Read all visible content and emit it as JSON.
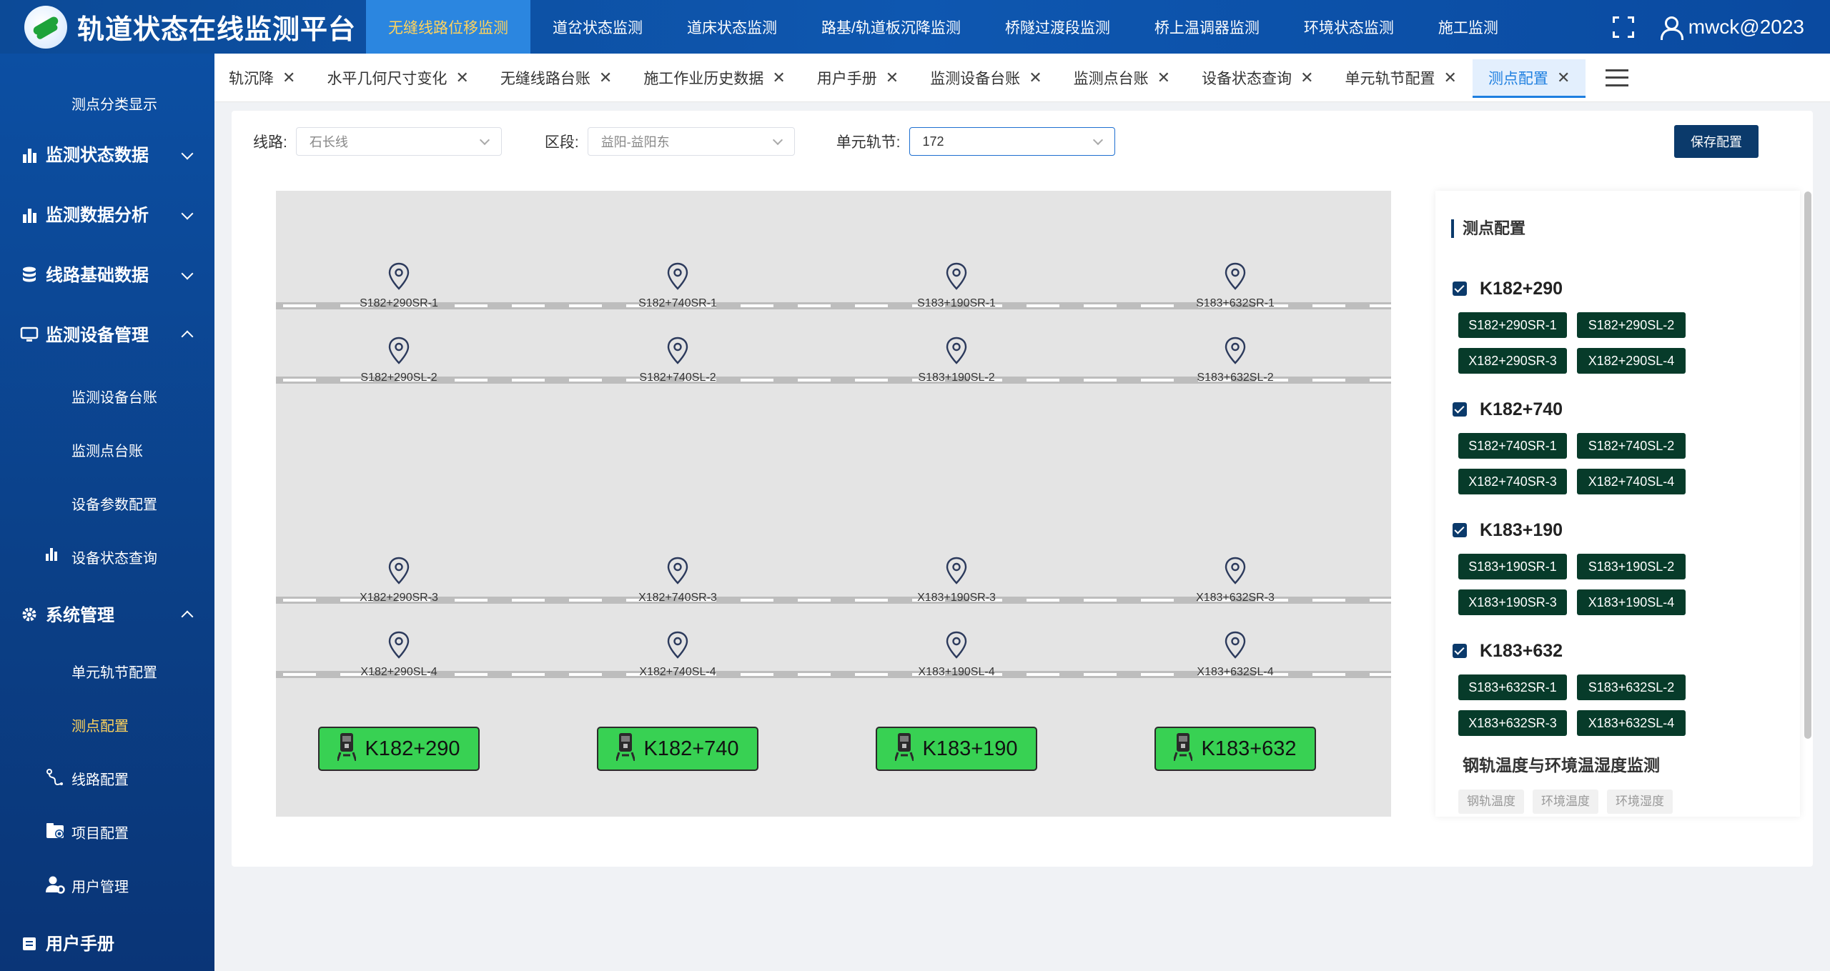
{
  "header": {
    "title": "轨道状态在线监测平台",
    "nav": [
      "无缝线路位移监测",
      "道岔状态监测",
      "道床状态监测",
      "路基/轨道板沉降监测",
      "桥隧过渡段监测",
      "桥上温调器监测",
      "环境状态监测",
      "施工监测"
    ],
    "username": "mwck@2023"
  },
  "sidebar": {
    "items": {
      "top_sub": "测点分类显示",
      "monitor_status": "监测状态数据",
      "monitor_analysis": "监测数据分析",
      "line_base": "线路基础数据",
      "device_mgmt": "监测设备管理",
      "device_ledger": "监测设备台账",
      "point_ledger": "监测点台账",
      "param_config": "设备参数配置",
      "status_query": "设备状态查询",
      "system_mgmt": "系统管理",
      "unit_config": "单元轨节配置",
      "point_config": "测点配置",
      "line_config": "线路配置",
      "project_config": "项目配置",
      "user_mgmt": "用户管理",
      "user_manual": "用户手册"
    }
  },
  "tabs": {
    "t0": "轨沉降",
    "t1": "水平几何尺寸变化",
    "t2": "无缝线路台账",
    "t3": "施工作业历史数据",
    "t4": "用户手册",
    "t5": "监测设备台账",
    "t6": "监测点台账",
    "t7": "设备状态查询",
    "t8": "单元轨节配置",
    "t9": "测点配置"
  },
  "filters": {
    "line_label": "线路:",
    "line_value": "石长线",
    "section_label": "区段:",
    "section_value": "益阳-益阳东",
    "unit_label": "单元轨节:",
    "unit_value": "172",
    "save_label": "保存配置"
  },
  "diagram": {
    "rows": [
      [
        "S182+290SR-1",
        "S182+740SR-1",
        "S183+190SR-1",
        "S183+632SR-1"
      ],
      [
        "S182+290SL-2",
        "S182+740SL-2",
        "S183+190SL-2",
        "S183+632SL-2"
      ],
      [
        "X182+290SR-3",
        "X182+740SR-3",
        "X183+190SR-3",
        "X183+632SR-3"
      ],
      [
        "X182+290SL-4",
        "X182+740SL-4",
        "X183+190SL-4",
        "X183+632SL-4"
      ]
    ],
    "stations": [
      "K182+290",
      "K182+740",
      "K183+190",
      "K183+632"
    ]
  },
  "panel": {
    "title": "测点配置",
    "groups": [
      {
        "name": "K182+290",
        "chips": [
          "S182+290SR-1",
          "S182+290SL-2",
          "X182+290SR-3",
          "X182+290SL-4"
        ]
      },
      {
        "name": "K182+740",
        "chips": [
          "S182+740SR-1",
          "S182+740SL-2",
          "X182+740SR-3",
          "X182+740SL-4"
        ]
      },
      {
        "name": "K183+190",
        "chips": [
          "S183+190SR-1",
          "S183+190SL-2",
          "X183+190SR-3",
          "X183+190SL-4"
        ]
      },
      {
        "name": "K183+632",
        "chips": [
          "S183+632SR-1",
          "S183+632SL-2",
          "X183+632SR-3",
          "X183+632SL-4"
        ]
      }
    ],
    "subtitle": "钢轨温度与环境温湿度监测",
    "tags": [
      "钢轨温度",
      "环境温度",
      "环境湿度"
    ]
  },
  "colors": {
    "header_bg": "#0e57b0",
    "active_nav": "#2b86e0",
    "active_text": "#ffd35c",
    "station_green": "#38d153",
    "chip_bg": "#073b2a",
    "save_btn": "#0b3a6b"
  },
  "icons": {
    "pin": "map-pin-icon",
    "station": "train-icon",
    "close": "close-icon",
    "checkbox": "checkbox-checked-icon"
  }
}
